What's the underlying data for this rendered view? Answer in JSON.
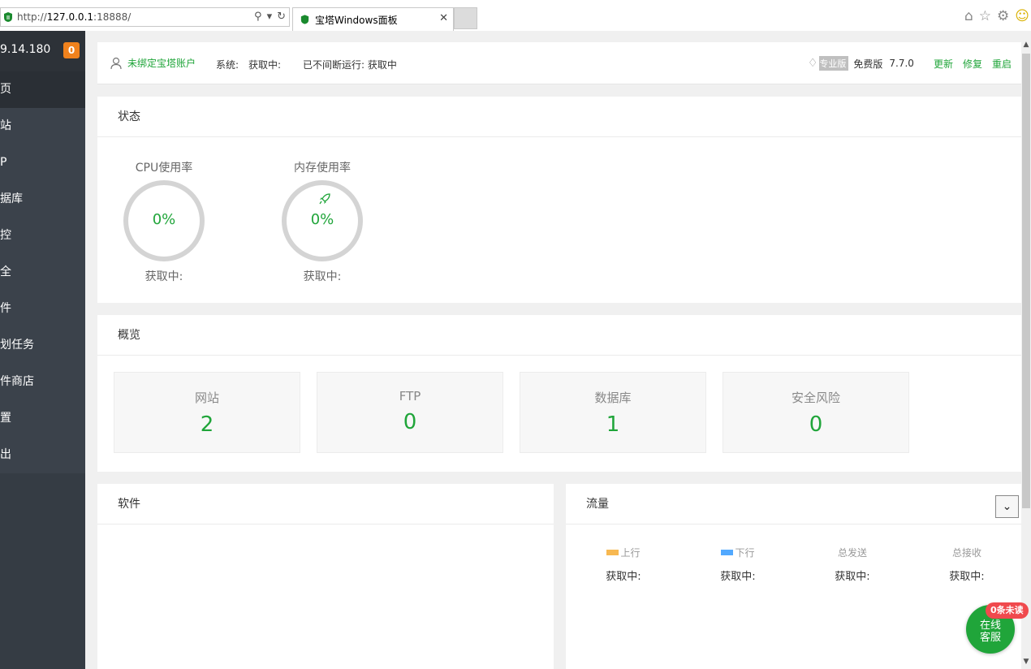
{
  "browser": {
    "url_prefix": "http://",
    "url_host": "127.0.0.1",
    "url_suffix": ":18888/",
    "tab_title": "宝塔Windows面板"
  },
  "sidebar": {
    "ip": "9.14.180",
    "badge": "0",
    "items": [
      {
        "label": "页",
        "active": true
      },
      {
        "label": "站"
      },
      {
        "label": "P"
      },
      {
        "label": "据库"
      },
      {
        "label": "控"
      },
      {
        "label": "全"
      },
      {
        "label": "件"
      },
      {
        "label": "划任务"
      },
      {
        "label": "件商店"
      },
      {
        "label": "置"
      },
      {
        "label": "出"
      }
    ]
  },
  "topbar": {
    "account": "未绑定宝塔账户",
    "system_label": "系统:",
    "system_value": "获取中:",
    "uptime": "已不间断运行: 获取中",
    "pro_label": "专业版",
    "edition": "免费版",
    "version": "7.7.0",
    "update": "更新",
    "repair": "修复",
    "restart": "重启"
  },
  "status": {
    "title": "状态",
    "cpu": {
      "label": "CPU使用率",
      "value": "0%",
      "sub": "获取中:"
    },
    "mem": {
      "label": "内存使用率",
      "value": "0%",
      "sub": "获取中:"
    }
  },
  "overview": {
    "title": "概览",
    "items": [
      {
        "label": "网站",
        "value": "2"
      },
      {
        "label": "FTP",
        "value": "0"
      },
      {
        "label": "数据库",
        "value": "1"
      },
      {
        "label": "安全风险",
        "value": "0"
      }
    ]
  },
  "software": {
    "title": "软件"
  },
  "traffic": {
    "title": "流量",
    "cols": [
      {
        "label": "上行",
        "value": "获取中:",
        "color": "#f7b851"
      },
      {
        "label": "下行",
        "value": "获取中:",
        "color": "#52a9ff"
      },
      {
        "label": "总发送",
        "value": "获取中:"
      },
      {
        "label": "总接收",
        "value": "获取中:"
      }
    ]
  },
  "support": {
    "badge": "0条未读",
    "line1": "在线",
    "line2": "客服"
  },
  "colors": {
    "accent": "#20a53a",
    "sidebar": "#353c44",
    "badge": "#f0821d"
  }
}
